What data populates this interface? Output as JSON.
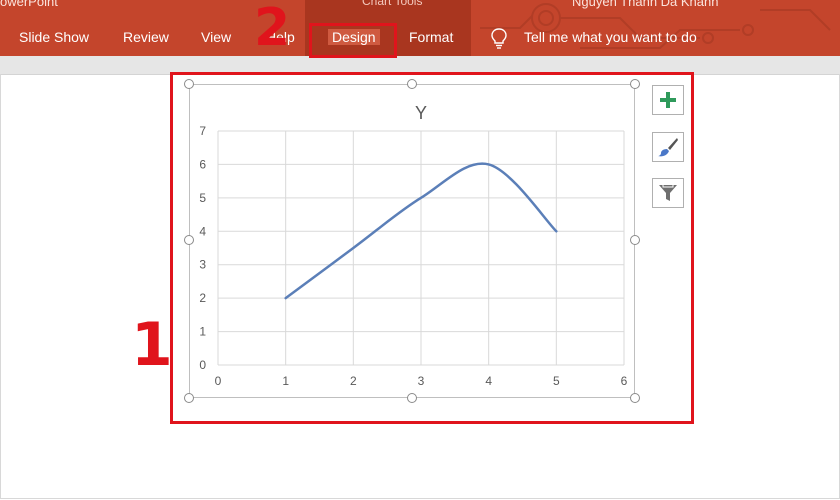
{
  "window": {
    "app_title": "owerPoint",
    "context_label": "Chart Tools",
    "user_name": "Nguyen Thanh Da Khanh"
  },
  "ribbon": {
    "tabs": [
      {
        "label": "Slide Show"
      },
      {
        "label": "Review"
      },
      {
        "label": "View"
      },
      {
        "label": "Help"
      },
      {
        "label": "Design"
      },
      {
        "label": "Format"
      }
    ],
    "tell_me": "Tell me what you want to do",
    "colors": {
      "ribbon": "#c4452c",
      "context_tab": "#a9361f"
    }
  },
  "annotations": {
    "step1": "1",
    "step2": "2",
    "color": "#e0141c"
  },
  "chart_tools": [
    {
      "icon": "plus-icon"
    },
    {
      "icon": "brush-icon"
    },
    {
      "icon": "filter-icon"
    }
  ],
  "chart_data": {
    "type": "line",
    "title": "Y",
    "xlabel": "",
    "ylabel": "",
    "xlim": [
      0,
      6
    ],
    "ylim": [
      0,
      7
    ],
    "xticks": [
      0,
      1,
      2,
      3,
      4,
      5,
      6
    ],
    "yticks": [
      0,
      1,
      2,
      3,
      4,
      5,
      6,
      7
    ],
    "grid": true,
    "smooth": true,
    "series": [
      {
        "x": [
          1,
          2,
          3,
          4,
          5
        ],
        "y": [
          2,
          3.5,
          5,
          6,
          4
        ],
        "color": "#5b7fb8"
      }
    ]
  }
}
